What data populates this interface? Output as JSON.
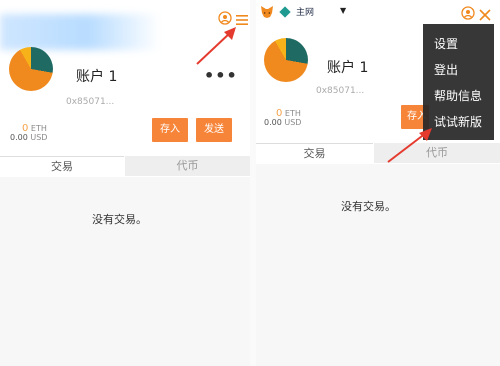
{
  "left": {
    "account_name": "账户 1",
    "address": "0x85071...",
    "more_label": "•••",
    "eth_amount": "0",
    "eth_unit": "ETH",
    "usd_amount": "0.00",
    "usd_unit": "USD",
    "deposit_label": "存入",
    "send_label": "发送",
    "tab_transactions": "交易",
    "tab_tokens": "代币",
    "empty_text": "没有交易。"
  },
  "right": {
    "network_label": "主网",
    "account_name": "账户 1",
    "address": "0x85071...",
    "eth_amount": "0",
    "eth_unit": "ETH",
    "usd_amount": "0.00",
    "usd_unit": "USD",
    "deposit_label": "存入",
    "tab_transactions": "交易",
    "tab_tokens": "代币",
    "empty_text": "没有交易。",
    "menu": [
      {
        "label": "设置"
      },
      {
        "label": "登出"
      },
      {
        "label": "帮助信息"
      },
      {
        "label": "试试新版"
      }
    ]
  },
  "colors": {
    "accent_orange": "#f6853a",
    "arrow_red": "#e53a2e",
    "network_teal": "#1f9a91",
    "menu_bg": "#282828"
  },
  "icons": [
    "metamask-fox-icon",
    "network-diamond-icon",
    "account-sync-icon",
    "hamburger-menu-icon",
    "close-icon",
    "red-arrow-annotation"
  ]
}
